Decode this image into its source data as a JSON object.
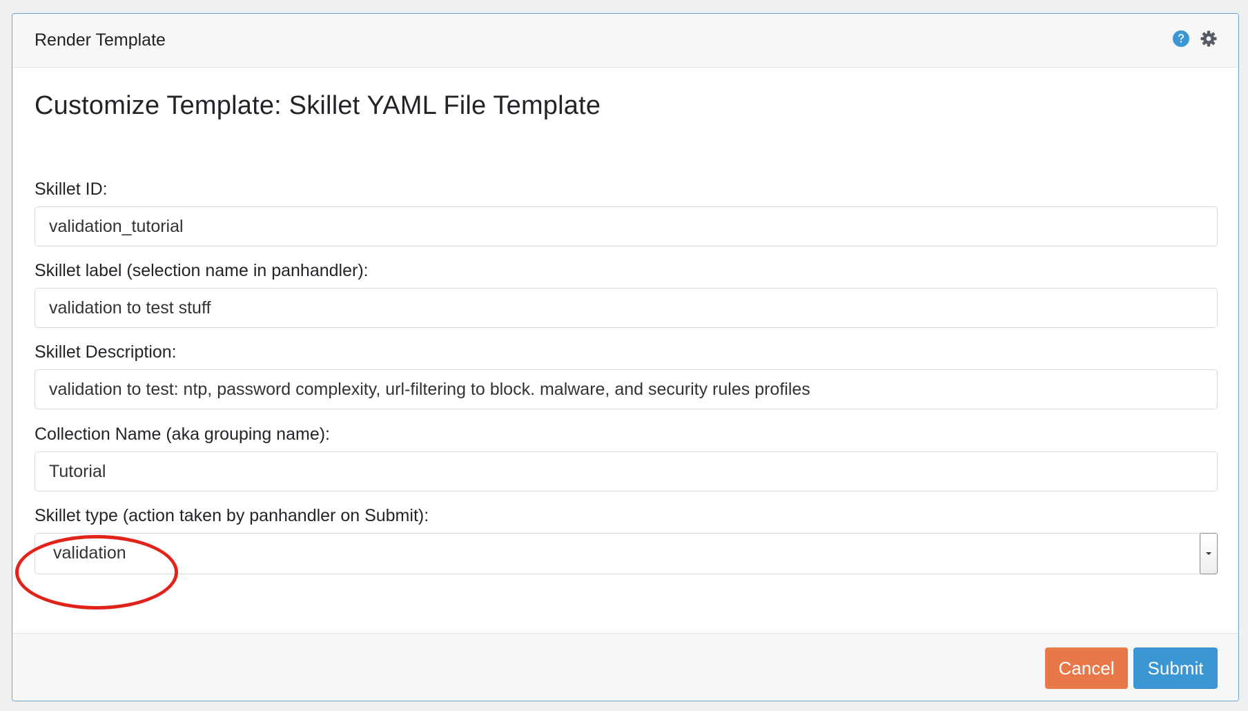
{
  "panel": {
    "title": "Render Template"
  },
  "header_icons": [
    "help-circle-icon",
    "gear-icon"
  ],
  "form": {
    "title": "Customize Template: Skillet YAML File Template",
    "fields": [
      {
        "label": "Skillet ID:",
        "value": "validation_tutorial"
      },
      {
        "label": "Skillet label (selection name in panhandler):",
        "value": "validation to test stuff"
      },
      {
        "label": "Skillet Description:",
        "value": "validation to test: ntp, password complexity, url-filtering to block. malware, and security rules profiles"
      },
      {
        "label": "Collection Name (aka grouping name):",
        "value": "Tutorial"
      }
    ],
    "select": {
      "label": "Skillet type (action taken by panhandler on Submit):",
      "value": "validation"
    }
  },
  "footer": {
    "cancel_label": "Cancel",
    "submit_label": "Submit"
  },
  "colors": {
    "accent_blue": "#3a97d4",
    "cancel_orange": "#e8784a",
    "annotation_red": "#e2231a",
    "panel_border": "#6fa3cf"
  }
}
